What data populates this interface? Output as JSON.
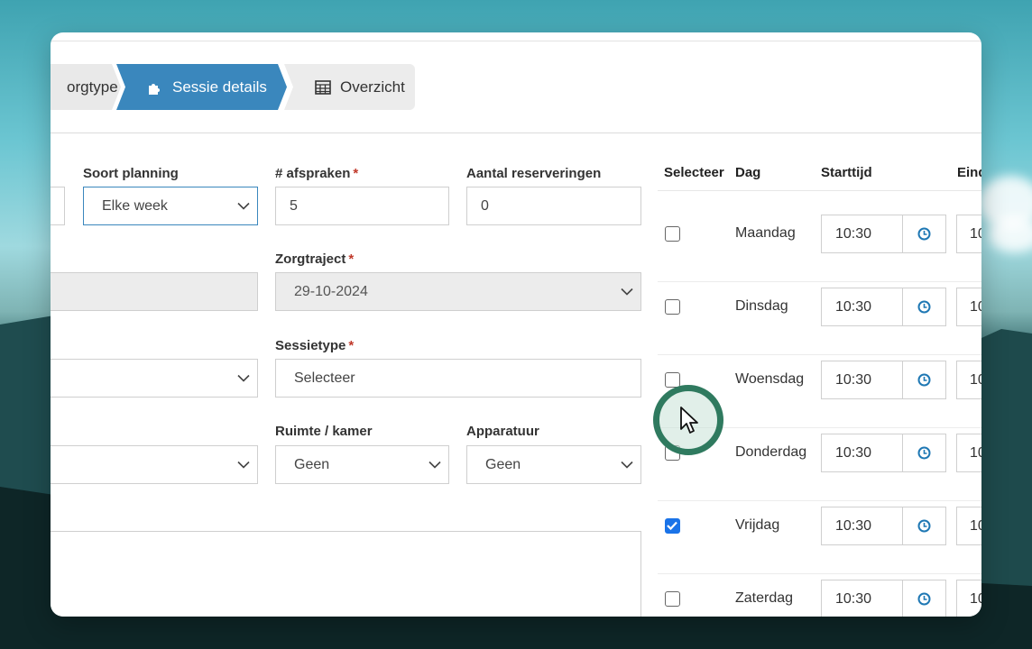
{
  "steps": [
    {
      "label": "orgtype"
    },
    {
      "label": "Sessie details",
      "icon": "puzzle-icon"
    },
    {
      "label": "Overzicht",
      "icon": "table-icon"
    }
  ],
  "form": {
    "soort_planning": {
      "label": "Soort planning",
      "value": "Elke week"
    },
    "afspraken": {
      "label": "# afspraken",
      "required": "*",
      "value": "5"
    },
    "reserveringen": {
      "label": "Aantal reserveringen",
      "value": "0"
    },
    "zorgtraject": {
      "label": "Zorgtraject",
      "required": "*",
      "value": "29-10-2024"
    },
    "sessietype": {
      "label": "Sessietype",
      "required": "*",
      "value": "Selecteer"
    },
    "ruimte": {
      "label": "Ruimte / kamer",
      "value": "Geen"
    },
    "apparatuur": {
      "label": "Apparatuur",
      "value": "Geen"
    }
  },
  "table": {
    "headers": {
      "select": "Selecteer",
      "day": "Dag",
      "start": "Starttijd",
      "end": "Eind"
    },
    "rows": [
      {
        "day": "Maandag",
        "start": "10:30",
        "end": "10",
        "checked": false
      },
      {
        "day": "Dinsdag",
        "start": "10:30",
        "end": "10",
        "checked": false
      },
      {
        "day": "Woensdag",
        "start": "10:30",
        "end": "10",
        "checked": false
      },
      {
        "day": "Donderdag",
        "start": "10:30",
        "end": "10",
        "checked": false
      },
      {
        "day": "Vrijdag",
        "start": "10:30",
        "end": "10",
        "checked": true
      },
      {
        "day": "Zaterdag",
        "start": "10:30",
        "end": "10",
        "checked": false
      }
    ]
  },
  "colors": {
    "accent": "#3a87bd",
    "checkbox": "#1a73e8",
    "required": "#c0392b",
    "cursor_ring": "#2f7a5f"
  }
}
